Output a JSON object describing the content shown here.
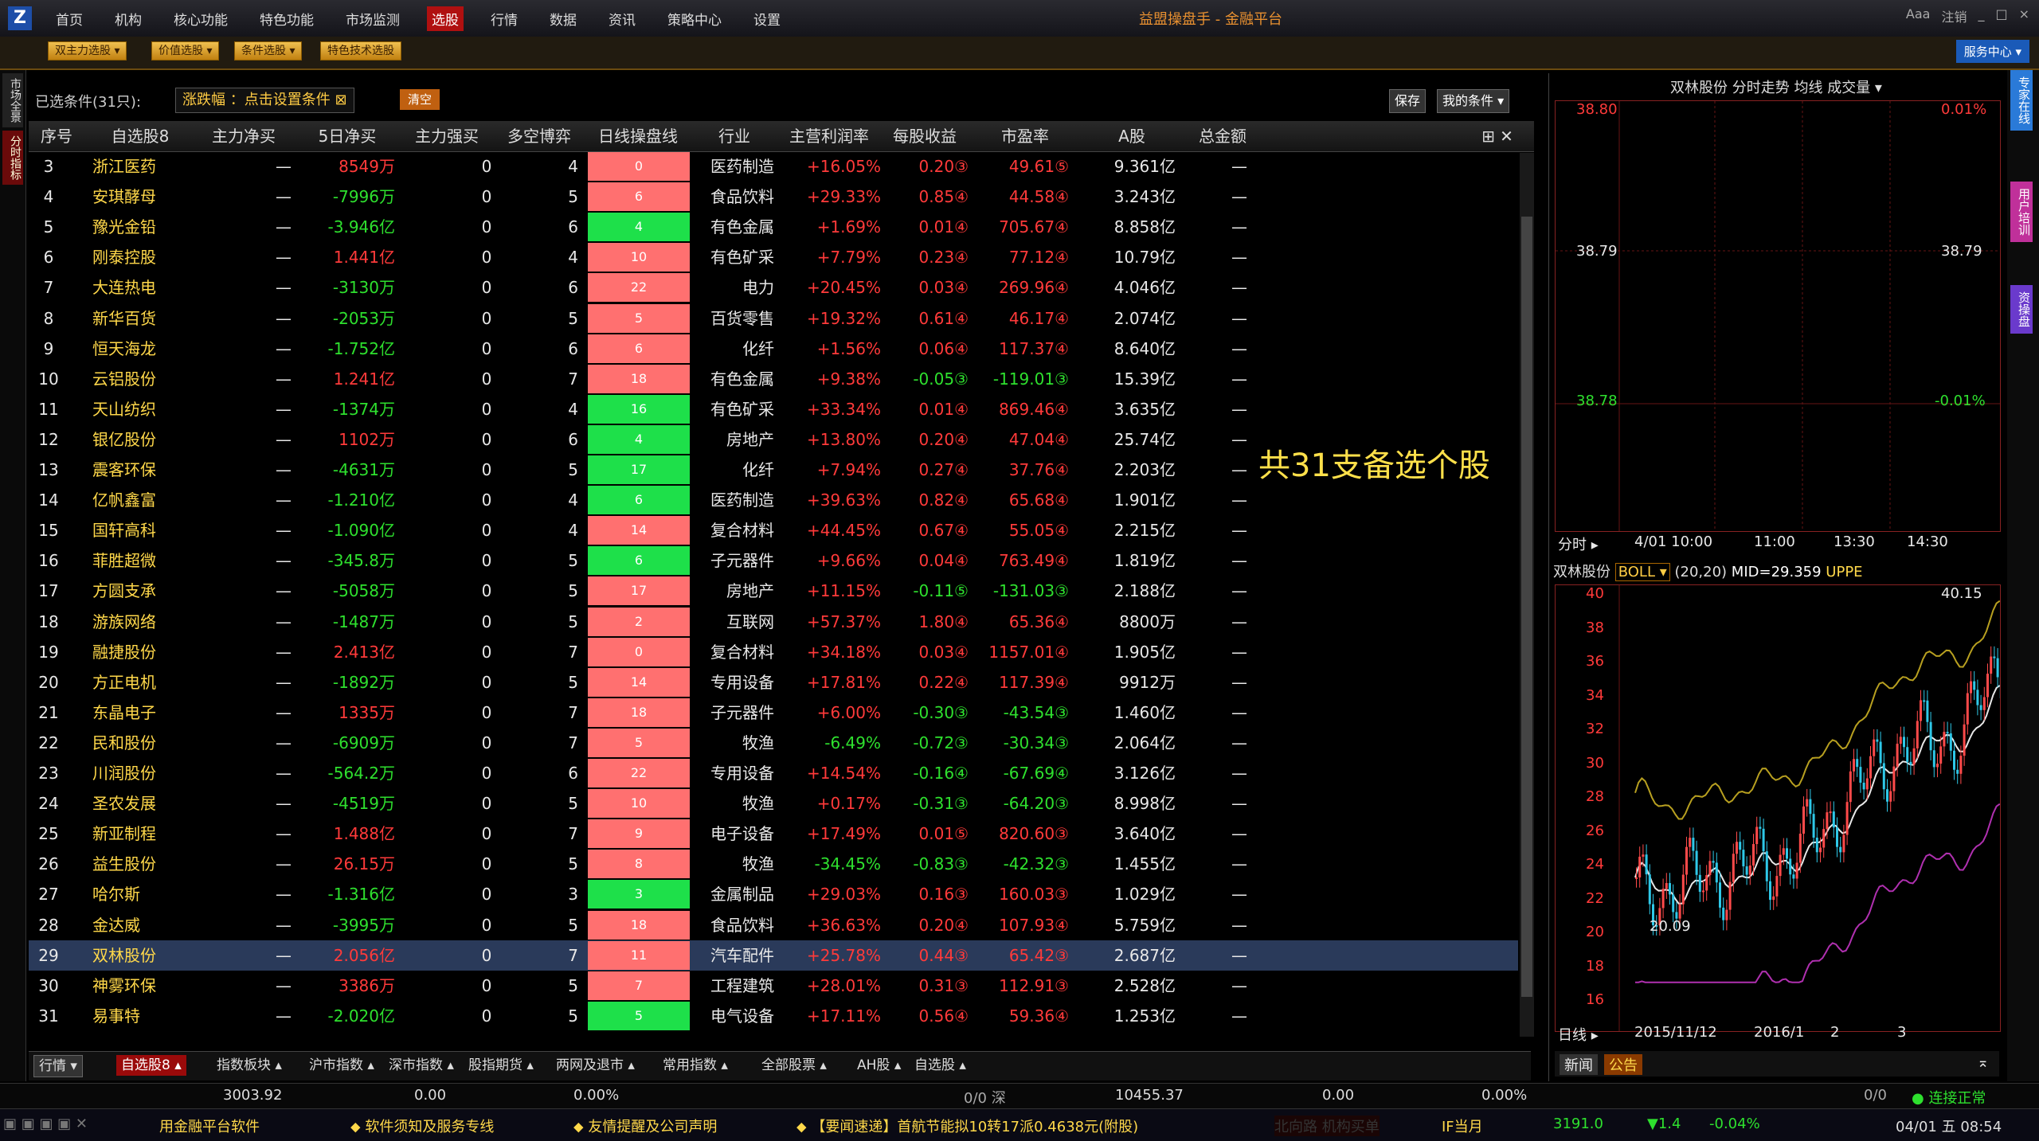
{
  "menubar": {
    "logo": "Z",
    "items": [
      "首页",
      "机构",
      "核心功能",
      "特色功能",
      "市场监测",
      "选股",
      "行情",
      "数据",
      "资讯",
      "策略中心",
      "设置"
    ],
    "active_index": 5,
    "app_title": "益盟操盘手 - 金融平台",
    "window_buttons": [
      "Ааа",
      "注销",
      "_",
      "□",
      "×"
    ]
  },
  "toolbar2": {
    "buttons": [
      "双主力选股 ▾",
      "价值选股 ▾",
      "条件选股 ▾",
      "特色技术选股"
    ],
    "service": "服务中心 ▾"
  },
  "lefttabs": [
    "市场全景",
    "分时指标"
  ],
  "filter": {
    "cond_label": "已选条件(31只):",
    "cond_tag": "涨跌幅 ：点击设置条件 ⊠",
    "clear": "清空",
    "save": "保存",
    "my_conditions": "我的条件 ▾"
  },
  "table": {
    "headers": [
      "序号",
      "自选股8",
      "主力净买",
      "5日净买",
      "主力强买",
      "多空博弈",
      "日线操盘线",
      "行业",
      "主营利润率",
      "每股收益",
      "市盈率",
      "A股",
      "总金额"
    ],
    "rows": [
      {
        "no": "3",
        "name": "浙江医药",
        "net": "—",
        "net5": "8549万",
        "strong": "0",
        "game": "4",
        "bar": "0",
        "bar_color": "red",
        "ind": "医药制造",
        "margin": "+16.05%",
        "eps": "0.20③",
        "pe": "49.61⑤",
        "a": "9.361亿",
        "total": "—"
      },
      {
        "no": "4",
        "name": "安琪酵母",
        "net": "—",
        "net5": "-7996万",
        "strong": "0",
        "game": "5",
        "bar": "6",
        "bar_color": "red",
        "ind": "食品饮料",
        "margin": "+29.33%",
        "eps": "0.85④",
        "pe": "44.58④",
        "a": "3.243亿",
        "total": "—"
      },
      {
        "no": "5",
        "name": "豫光金铅",
        "net": "—",
        "net5": "-3.946亿",
        "strong": "0",
        "game": "6",
        "bar": "4",
        "bar_color": "green",
        "ind": "有色金属",
        "margin": "+1.69%",
        "eps": "0.01④",
        "pe": "705.67④",
        "a": "8.858亿",
        "total": "—"
      },
      {
        "no": "6",
        "name": "刚泰控股",
        "net": "—",
        "net5": "1.441亿",
        "strong": "0",
        "game": "4",
        "bar": "10",
        "bar_color": "red",
        "ind": "有色矿采",
        "margin": "+7.79%",
        "eps": "0.23④",
        "pe": "77.12④",
        "a": "10.79亿",
        "total": "—"
      },
      {
        "no": "7",
        "name": "大连热电",
        "net": "—",
        "net5": "-3130万",
        "strong": "0",
        "game": "6",
        "bar": "22",
        "bar_color": "red",
        "ind": "电力",
        "margin": "+20.45%",
        "eps": "0.03④",
        "pe": "269.96④",
        "a": "4.046亿",
        "total": "—"
      },
      {
        "no": "8",
        "name": "新华百货",
        "net": "—",
        "net5": "-2053万",
        "strong": "0",
        "game": "5",
        "bar": "5",
        "bar_color": "red",
        "ind": "百货零售",
        "margin": "+19.32%",
        "eps": "0.61④",
        "pe": "46.17④",
        "a": "2.074亿",
        "total": "—"
      },
      {
        "no": "9",
        "name": "恒天海龙",
        "net": "—",
        "net5": "-1.752亿",
        "strong": "0",
        "game": "6",
        "bar": "6",
        "bar_color": "red",
        "ind": "化纤",
        "margin": "+1.56%",
        "eps": "0.06④",
        "pe": "117.37④",
        "a": "8.640亿",
        "total": "—"
      },
      {
        "no": "10",
        "name": "云铝股份",
        "net": "—",
        "net5": "1.241亿",
        "strong": "0",
        "game": "7",
        "bar": "18",
        "bar_color": "red",
        "ind": "有色金属",
        "margin": "+9.38%",
        "eps": "-0.05③",
        "pe": "-119.01③",
        "a": "15.39亿",
        "total": "—"
      },
      {
        "no": "11",
        "name": "天山纺织",
        "net": "—",
        "net5": "-1374万",
        "strong": "0",
        "game": "4",
        "bar": "16",
        "bar_color": "green",
        "ind": "有色矿采",
        "margin": "+33.34%",
        "eps": "0.01④",
        "pe": "869.46④",
        "a": "3.635亿",
        "total": "—"
      },
      {
        "no": "12",
        "name": "银亿股份",
        "net": "—",
        "net5": "1102万",
        "strong": "0",
        "game": "6",
        "bar": "4",
        "bar_color": "green",
        "ind": "房地产",
        "margin": "+13.80%",
        "eps": "0.20④",
        "pe": "47.04④",
        "a": "25.74亿",
        "total": "—"
      },
      {
        "no": "13",
        "name": "震客环保",
        "net": "—",
        "net5": "-4631万",
        "strong": "0",
        "game": "5",
        "bar": "17",
        "bar_color": "green",
        "ind": "化纤",
        "margin": "+7.94%",
        "eps": "0.27④",
        "pe": "37.76④",
        "a": "2.203亿",
        "total": "—"
      },
      {
        "no": "14",
        "name": "亿帆鑫富",
        "net": "—",
        "net5": "-1.210亿",
        "strong": "0",
        "game": "4",
        "bar": "6",
        "bar_color": "green",
        "ind": "医药制造",
        "margin": "+39.63%",
        "eps": "0.82④",
        "pe": "65.68④",
        "a": "1.901亿",
        "total": "—"
      },
      {
        "no": "15",
        "name": "国轩高科",
        "net": "—",
        "net5": "-1.090亿",
        "strong": "0",
        "game": "4",
        "bar": "14",
        "bar_color": "red",
        "ind": "复合材料",
        "margin": "+44.45%",
        "eps": "0.67④",
        "pe": "55.05④",
        "a": "2.215亿",
        "total": "—"
      },
      {
        "no": "16",
        "name": "菲胜超微",
        "net": "—",
        "net5": "-345.8万",
        "strong": "0",
        "game": "5",
        "bar": "6",
        "bar_color": "green",
        "ind": "子元器件",
        "margin": "+9.66%",
        "eps": "0.04④",
        "pe": "763.49④",
        "a": "1.819亿",
        "total": "—"
      },
      {
        "no": "17",
        "name": "方圆支承",
        "net": "—",
        "net5": "-5058万",
        "strong": "0",
        "game": "5",
        "bar": "17",
        "bar_color": "red",
        "ind": "房地产",
        "margin": "+11.15%",
        "eps": "-0.11⑤",
        "pe": "-131.03③",
        "a": "2.188亿",
        "total": "—"
      },
      {
        "no": "18",
        "name": "游族网络",
        "net": "—",
        "net5": "-1487万",
        "strong": "0",
        "game": "5",
        "bar": "2",
        "bar_color": "red",
        "ind": "互联网",
        "margin": "+57.37%",
        "eps": "1.80④",
        "pe": "65.36④",
        "a": "8800万",
        "total": "—"
      },
      {
        "no": "19",
        "name": "融捷股份",
        "net": "—",
        "net5": "2.413亿",
        "strong": "0",
        "game": "7",
        "bar": "0",
        "bar_color": "red",
        "ind": "复合材料",
        "margin": "+34.18%",
        "eps": "0.03④",
        "pe": "1157.01④",
        "a": "1.905亿",
        "total": "—"
      },
      {
        "no": "20",
        "name": "方正电机",
        "net": "—",
        "net5": "-1892万",
        "strong": "0",
        "game": "5",
        "bar": "14",
        "bar_color": "red",
        "ind": "专用设备",
        "margin": "+17.81%",
        "eps": "0.22④",
        "pe": "117.39④",
        "a": "9912万",
        "total": "—"
      },
      {
        "no": "21",
        "name": "东晶电子",
        "net": "—",
        "net5": "1335万",
        "strong": "0",
        "game": "7",
        "bar": "18",
        "bar_color": "red",
        "ind": "子元器件",
        "margin": "+6.00%",
        "eps": "-0.30③",
        "pe": "-43.54③",
        "a": "1.460亿",
        "total": "—"
      },
      {
        "no": "22",
        "name": "民和股份",
        "net": "—",
        "net5": "-6909万",
        "strong": "0",
        "game": "7",
        "bar": "5",
        "bar_color": "red",
        "ind": "牧渔",
        "margin": "-6.49%",
        "eps": "-0.72③",
        "pe": "-30.34③",
        "a": "2.064亿",
        "total": "—"
      },
      {
        "no": "23",
        "name": "川润股份",
        "net": "—",
        "net5": "-564.2万",
        "strong": "0",
        "game": "6",
        "bar": "22",
        "bar_color": "red",
        "ind": "专用设备",
        "margin": "+14.54%",
        "eps": "-0.16④",
        "pe": "-67.69④",
        "a": "3.126亿",
        "total": "—"
      },
      {
        "no": "24",
        "name": "圣农发展",
        "net": "—",
        "net5": "-4519万",
        "strong": "0",
        "game": "5",
        "bar": "10",
        "bar_color": "red",
        "ind": "牧渔",
        "margin": "+0.17%",
        "eps": "-0.31③",
        "pe": "-64.20③",
        "a": "8.998亿",
        "total": "—"
      },
      {
        "no": "25",
        "name": "新亚制程",
        "net": "—",
        "net5": "1.488亿",
        "strong": "0",
        "game": "7",
        "bar": "9",
        "bar_color": "red",
        "ind": "电子设备",
        "margin": "+17.49%",
        "eps": "0.01⑤",
        "pe": "820.60③",
        "a": "3.640亿",
        "total": "—"
      },
      {
        "no": "26",
        "name": "益生股份",
        "net": "—",
        "net5": "26.15万",
        "strong": "0",
        "game": "5",
        "bar": "8",
        "bar_color": "red",
        "ind": "牧渔",
        "margin": "-34.45%",
        "eps": "-0.83③",
        "pe": "-42.32③",
        "a": "1.455亿",
        "total": "—"
      },
      {
        "no": "27",
        "name": "哈尔斯",
        "net": "—",
        "net5": "-1.316亿",
        "strong": "0",
        "game": "3",
        "bar": "3",
        "bar_color": "green",
        "ind": "金属制品",
        "margin": "+29.03%",
        "eps": "0.16③",
        "pe": "160.03③",
        "a": "1.029亿",
        "total": "—"
      },
      {
        "no": "28",
        "name": "金达威",
        "net": "—",
        "net5": "-3995万",
        "strong": "0",
        "game": "5",
        "bar": "18",
        "bar_color": "red",
        "ind": "食品饮料",
        "margin": "+36.63%",
        "eps": "0.20④",
        "pe": "107.93④",
        "a": "5.759亿",
        "total": "—"
      },
      {
        "no": "29",
        "name": "双林股份",
        "net": "—",
        "net5": "2.056亿",
        "strong": "0",
        "game": "7",
        "bar": "11",
        "bar_color": "red",
        "ind": "汽车配件",
        "margin": "+25.78%",
        "eps": "0.44③",
        "pe": "65.42③",
        "a": "2.687亿",
        "total": "—",
        "selected": true
      },
      {
        "no": "30",
        "name": "神雾环保",
        "net": "—",
        "net5": "3386万",
        "strong": "0",
        "game": "5",
        "bar": "7",
        "bar_color": "red",
        "ind": "工程建筑",
        "margin": "+28.01%",
        "eps": "0.31③",
        "pe": "112.91③",
        "a": "2.528亿",
        "total": "—"
      },
      {
        "no": "31",
        "name": "易事特",
        "net": "—",
        "net5": "-2.020亿",
        "strong": "0",
        "game": "5",
        "bar": "5",
        "bar_color": "green",
        "ind": "电气设备",
        "margin": "+17.11%",
        "eps": "0.56④",
        "pe": "59.36④",
        "a": "1.253亿",
        "total": "—"
      }
    ]
  },
  "annotation": "共31支备选个股",
  "bottabs": [
    "行情 ▾",
    "自选股8 ▴",
    "指数板块 ▴",
    "沪市指数 ▴",
    "深市指数 ▴",
    "股指期货 ▴",
    "两网及退市 ▴",
    "常用指数 ▴",
    "全部股票 ▴",
    "AH股 ▴",
    "自选股 ▴"
  ],
  "status": {
    "items": [
      "3003.92",
      "0.00",
      "0.00%",
      "0/0 深",
      "10455.37",
      "0.00",
      "0.00%",
      "0/0",
      "连接正常"
    ]
  },
  "ticker": {
    "items": [
      "用金融平台软件",
      "软件须知及服务专线",
      "友情提醒及公司声明",
      "【要闻速递】首航节能拟10转17派0.4638元(附股)",
      "北向路  机构买单",
      "IF当月",
      "3191.0",
      "▼1.4",
      "-0.04%",
      "04/01 五 08:54"
    ]
  },
  "intraday": {
    "title": "双林股份  分时走势 均线 成交量 ▾",
    "y_left": [
      "38.80",
      "38.79",
      "38.78"
    ],
    "y_right": [
      "0.01%",
      "38.79",
      "-0.01%"
    ],
    "x_labels": [
      "分时 ▸",
      "4/01 10:00",
      "11:00",
      "13:30",
      "14:30"
    ]
  },
  "kline": {
    "title_name": "双林股份",
    "indicator": "BOLL ▾",
    "params": "(20,20)",
    "mid": "MID=29.359",
    "upper": "UPPE",
    "high_label": "40.15",
    "low_label": "20.09",
    "y_labels": [
      "40",
      "38",
      "36",
      "34",
      "32",
      "30",
      "28",
      "26",
      "24",
      "22",
      "20",
      "18",
      "16"
    ],
    "x_labels": [
      "日线 ▸",
      "2015/11/12",
      "2016/1",
      "2",
      "3"
    ]
  },
  "rtabs": [
    "新闻",
    "公告"
  ],
  "edgetabs": [
    "专家在线",
    "用户培训",
    "资操盘"
  ],
  "colors": {
    "up": "#ff3a3a",
    "down": "#2ee02e",
    "accent": "#ffd84a"
  }
}
